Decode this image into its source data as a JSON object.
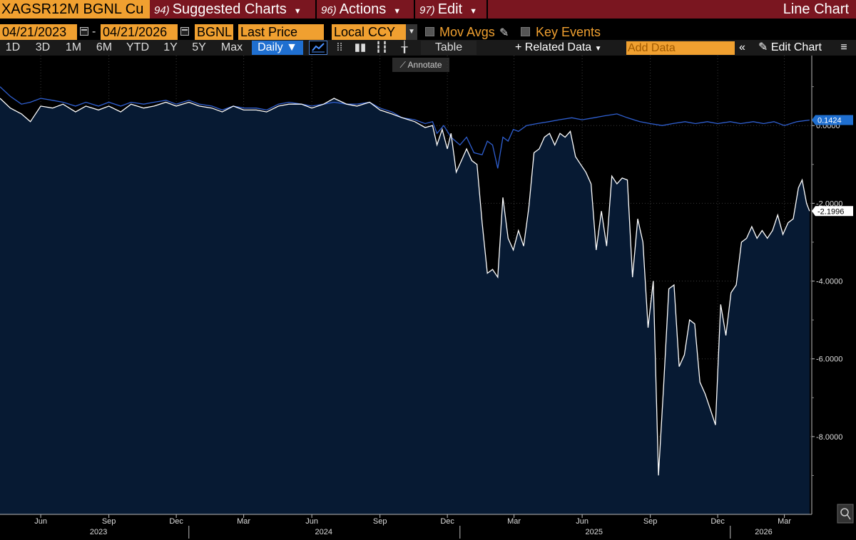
{
  "header": {
    "ticker": "XAGSR12M BGNL Cu",
    "menu": [
      {
        "num": "94)",
        "label": "Suggested Charts"
      },
      {
        "num": "96)",
        "label": "Actions"
      },
      {
        "num": "97)",
        "label": "Edit"
      }
    ],
    "chart_title": "Line Chart"
  },
  "toolbar": {
    "start_date": "04/21/2023",
    "end_date": "04/21/2026",
    "date_sep": "-",
    "source": "BGNL",
    "field": "Last Price",
    "currency": "Local CCY",
    "mov_avgs": "Mov Avgs",
    "key_events": "Key Events"
  },
  "periods": [
    "1D",
    "3D",
    "1M",
    "6M",
    "YTD",
    "1Y",
    "5Y",
    "Max"
  ],
  "frequency": "Daily",
  "table_label": "Table",
  "related_data": "Related Data",
  "add_data_placeholder": "Add Data",
  "edit_chart": "Edit Chart",
  "annotate": "Annotate",
  "colors": {
    "accent_orange": "#f0a030",
    "topbar_red": "#7a1620",
    "area_fill": "#071a33",
    "white_series": "#ffffff",
    "blue_series": "#2f5fd0",
    "active_tab": "#1f6fd0"
  },
  "chart_data": {
    "type": "area",
    "ylim": [
      -10,
      1.8
    ],
    "y_ticks": [
      0,
      -2,
      -4,
      -6,
      -8
    ],
    "y_tick_labels": [
      "0.0000",
      "-2.0000",
      "-4.0000",
      "-6.0000",
      "-8.0000"
    ],
    "x_months": [
      {
        "date": "2023-06-15",
        "label": "Jun"
      },
      {
        "date": "2023-09-15",
        "label": "Sep"
      },
      {
        "date": "2023-12-15",
        "label": "Dec"
      },
      {
        "date": "2024-03-15",
        "label": "Mar"
      },
      {
        "date": "2024-06-15",
        "label": "Jun"
      },
      {
        "date": "2024-09-15",
        "label": "Sep"
      },
      {
        "date": "2024-12-15",
        "label": "Dec"
      },
      {
        "date": "2025-03-15",
        "label": "Mar"
      },
      {
        "date": "2025-06-15",
        "label": "Jun"
      },
      {
        "date": "2025-09-15",
        "label": "Sep"
      },
      {
        "date": "2025-12-15",
        "label": "Dec"
      },
      {
        "date": "2026-03-15",
        "label": "Mar"
      }
    ],
    "x_years": [
      {
        "date": "2023-09-01",
        "label": "2023"
      },
      {
        "date": "2024-07-01",
        "label": "2024"
      },
      {
        "date": "2025-07-01",
        "label": "2025"
      },
      {
        "date": "2026-02-15",
        "label": "2026"
      }
    ],
    "year_boundaries": [
      "2024-01-01",
      "2025-01-01",
      "2026-01-01"
    ],
    "x_range": [
      "2023-04-21",
      "2026-04-21"
    ],
    "grid": true,
    "last_values": [
      {
        "series": "blue",
        "value": 0.1424,
        "label": "0.1424"
      },
      {
        "series": "white",
        "value": -2.1996,
        "label": "-2.1996"
      }
    ],
    "series": [
      {
        "id": "white",
        "area": true,
        "points": [
          [
            "2023-04-21",
            0.7
          ],
          [
            "2023-05-05",
            0.45
          ],
          [
            "2023-05-20",
            0.3
          ],
          [
            "2023-06-01",
            0.1
          ],
          [
            "2023-06-15",
            0.5
          ],
          [
            "2023-07-01",
            0.45
          ],
          [
            "2023-07-15",
            0.55
          ],
          [
            "2023-08-01",
            0.35
          ],
          [
            "2023-08-15",
            0.5
          ],
          [
            "2023-09-01",
            0.4
          ],
          [
            "2023-09-15",
            0.5
          ],
          [
            "2023-10-01",
            0.35
          ],
          [
            "2023-10-15",
            0.55
          ],
          [
            "2023-11-01",
            0.45
          ],
          [
            "2023-11-15",
            0.5
          ],
          [
            "2023-12-01",
            0.6
          ],
          [
            "2023-12-15",
            0.5
          ],
          [
            "2024-01-01",
            0.6
          ],
          [
            "2024-01-15",
            0.5
          ],
          [
            "2024-02-01",
            0.45
          ],
          [
            "2024-02-15",
            0.35
          ],
          [
            "2024-03-01",
            0.5
          ],
          [
            "2024-03-15",
            0.4
          ],
          [
            "2024-04-01",
            0.4
          ],
          [
            "2024-04-15",
            0.35
          ],
          [
            "2024-05-01",
            0.5
          ],
          [
            "2024-05-15",
            0.55
          ],
          [
            "2024-06-01",
            0.55
          ],
          [
            "2024-06-15",
            0.45
          ],
          [
            "2024-07-01",
            0.55
          ],
          [
            "2024-07-15",
            0.7
          ],
          [
            "2024-08-01",
            0.55
          ],
          [
            "2024-08-15",
            0.5
          ],
          [
            "2024-09-01",
            0.6
          ],
          [
            "2024-09-15",
            0.4
          ],
          [
            "2024-10-01",
            0.3
          ],
          [
            "2024-10-15",
            0.2
          ],
          [
            "2024-11-01",
            0.1
          ],
          [
            "2024-11-15",
            -0.05
          ],
          [
            "2024-11-25",
            0.0
          ],
          [
            "2024-12-01",
            -0.5
          ],
          [
            "2024-12-08",
            -0.1
          ],
          [
            "2024-12-15",
            -0.6
          ],
          [
            "2024-12-20",
            -0.2
          ],
          [
            "2024-12-27",
            -1.2
          ],
          [
            "2025-01-03",
            -0.9
          ],
          [
            "2025-01-10",
            -0.6
          ],
          [
            "2025-01-17",
            -0.9
          ],
          [
            "2025-01-24",
            -1.0
          ],
          [
            "2025-01-31",
            -2.5
          ],
          [
            "2025-02-07",
            -3.8
          ],
          [
            "2025-02-14",
            -3.7
          ],
          [
            "2025-02-21",
            -3.9
          ],
          [
            "2025-02-28",
            -1.85
          ],
          [
            "2025-03-07",
            -2.9
          ],
          [
            "2025-03-14",
            -3.2
          ],
          [
            "2025-03-21",
            -2.7
          ],
          [
            "2025-03-28",
            -3.1
          ],
          [
            "2025-04-04",
            -2.1
          ],
          [
            "2025-04-11",
            -0.7
          ],
          [
            "2025-04-18",
            -0.6
          ],
          [
            "2025-04-25",
            -0.3
          ],
          [
            "2025-05-02",
            -0.2
          ],
          [
            "2025-05-09",
            -0.5
          ],
          [
            "2025-05-16",
            -0.2
          ],
          [
            "2025-05-23",
            -0.3
          ],
          [
            "2025-05-30",
            -0.15
          ],
          [
            "2025-06-06",
            -0.8
          ],
          [
            "2025-06-13",
            -1.0
          ],
          [
            "2025-06-20",
            -1.2
          ],
          [
            "2025-06-27",
            -1.5
          ],
          [
            "2025-07-04",
            -3.2
          ],
          [
            "2025-07-11",
            -2.2
          ],
          [
            "2025-07-18",
            -3.1
          ],
          [
            "2025-07-25",
            -1.3
          ],
          [
            "2025-08-01",
            -1.5
          ],
          [
            "2025-08-08",
            -1.35
          ],
          [
            "2025-08-15",
            -1.4
          ],
          [
            "2025-08-22",
            -3.9
          ],
          [
            "2025-08-29",
            -2.4
          ],
          [
            "2025-09-05",
            -3.0
          ],
          [
            "2025-09-12",
            -5.2
          ],
          [
            "2025-09-19",
            -4.0
          ],
          [
            "2025-09-26",
            -9.0
          ],
          [
            "2025-10-03",
            -6.7
          ],
          [
            "2025-10-10",
            -4.2
          ],
          [
            "2025-10-17",
            -4.1
          ],
          [
            "2025-10-24",
            -6.2
          ],
          [
            "2025-10-31",
            -5.9
          ],
          [
            "2025-11-07",
            -5.0
          ],
          [
            "2025-11-14",
            -5.1
          ],
          [
            "2025-11-21",
            -6.6
          ],
          [
            "2025-11-28",
            -6.9
          ],
          [
            "2025-12-05",
            -7.3
          ],
          [
            "2025-12-12",
            -7.7
          ],
          [
            "2025-12-19",
            -4.6
          ],
          [
            "2025-12-26",
            -5.4
          ],
          [
            "2026-01-02",
            -4.3
          ],
          [
            "2026-01-09",
            -4.1
          ],
          [
            "2026-01-16",
            -3.0
          ],
          [
            "2026-01-23",
            -2.9
          ],
          [
            "2026-01-30",
            -2.6
          ],
          [
            "2026-02-06",
            -2.9
          ],
          [
            "2026-02-13",
            -2.7
          ],
          [
            "2026-02-20",
            -2.9
          ],
          [
            "2026-02-27",
            -2.7
          ],
          [
            "2026-03-06",
            -2.3
          ],
          [
            "2026-03-13",
            -2.8
          ],
          [
            "2026-03-20",
            -2.5
          ],
          [
            "2026-03-27",
            -2.4
          ],
          [
            "2026-04-03",
            -1.6
          ],
          [
            "2026-04-08",
            -1.4
          ],
          [
            "2026-04-14",
            -2.0
          ],
          [
            "2026-04-18",
            -2.1996
          ]
        ]
      },
      {
        "id": "blue",
        "area": false,
        "points": [
          [
            "2023-04-21",
            1.0
          ],
          [
            "2023-05-05",
            0.75
          ],
          [
            "2023-05-20",
            0.55
          ],
          [
            "2023-06-01",
            0.6
          ],
          [
            "2023-06-15",
            0.7
          ],
          [
            "2023-07-01",
            0.65
          ],
          [
            "2023-07-15",
            0.6
          ],
          [
            "2023-08-01",
            0.5
          ],
          [
            "2023-08-15",
            0.6
          ],
          [
            "2023-09-01",
            0.5
          ],
          [
            "2023-09-15",
            0.6
          ],
          [
            "2023-10-01",
            0.5
          ],
          [
            "2023-10-15",
            0.6
          ],
          [
            "2023-11-01",
            0.55
          ],
          [
            "2023-11-15",
            0.6
          ],
          [
            "2023-12-01",
            0.65
          ],
          [
            "2023-12-15",
            0.55
          ],
          [
            "2024-01-01",
            0.65
          ],
          [
            "2024-01-15",
            0.55
          ],
          [
            "2024-02-01",
            0.5
          ],
          [
            "2024-02-15",
            0.4
          ],
          [
            "2024-03-01",
            0.5
          ],
          [
            "2024-03-15",
            0.45
          ],
          [
            "2024-04-01",
            0.45
          ],
          [
            "2024-04-15",
            0.4
          ],
          [
            "2024-05-01",
            0.55
          ],
          [
            "2024-05-15",
            0.6
          ],
          [
            "2024-06-01",
            0.55
          ],
          [
            "2024-06-15",
            0.5
          ],
          [
            "2024-07-01",
            0.55
          ],
          [
            "2024-07-15",
            0.6
          ],
          [
            "2024-08-01",
            0.55
          ],
          [
            "2024-08-15",
            0.55
          ],
          [
            "2024-09-01",
            0.6
          ],
          [
            "2024-09-15",
            0.45
          ],
          [
            "2024-10-01",
            0.35
          ],
          [
            "2024-10-15",
            0.2
          ],
          [
            "2024-11-01",
            0.15
          ],
          [
            "2024-11-15",
            0.05
          ],
          [
            "2024-11-25",
            0.1
          ],
          [
            "2024-12-01",
            -0.2
          ],
          [
            "2024-12-10",
            0.0
          ],
          [
            "2024-12-20",
            -0.3
          ],
          [
            "2025-01-01",
            -0.5
          ],
          [
            "2025-01-10",
            -0.3
          ],
          [
            "2025-01-20",
            -0.7
          ],
          [
            "2025-01-31",
            -0.75
          ],
          [
            "2025-02-07",
            -0.4
          ],
          [
            "2025-02-14",
            -0.5
          ],
          [
            "2025-02-21",
            -1.1
          ],
          [
            "2025-02-28",
            -0.3
          ],
          [
            "2025-03-07",
            -0.4
          ],
          [
            "2025-03-14",
            -0.1
          ],
          [
            "2025-03-21",
            -0.15
          ],
          [
            "2025-04-01",
            0.0
          ],
          [
            "2025-04-15",
            0.05
          ],
          [
            "2025-05-01",
            0.1
          ],
          [
            "2025-05-15",
            0.15
          ],
          [
            "2025-06-01",
            0.2
          ],
          [
            "2025-06-15",
            0.15
          ],
          [
            "2025-07-01",
            0.2
          ],
          [
            "2025-07-15",
            0.25
          ],
          [
            "2025-08-01",
            0.3
          ],
          [
            "2025-08-15",
            0.2
          ],
          [
            "2025-09-01",
            0.1
          ],
          [
            "2025-09-15",
            0.05
          ],
          [
            "2025-10-01",
            0.0
          ],
          [
            "2025-10-15",
            0.05
          ],
          [
            "2025-11-01",
            0.1
          ],
          [
            "2025-11-15",
            0.05
          ],
          [
            "2025-12-01",
            0.1
          ],
          [
            "2025-12-15",
            0.05
          ],
          [
            "2026-01-01",
            0.1
          ],
          [
            "2026-01-15",
            0.05
          ],
          [
            "2026-02-01",
            0.1
          ],
          [
            "2026-02-15",
            0.05
          ],
          [
            "2026-03-01",
            0.1
          ],
          [
            "2026-03-15",
            0.0
          ],
          [
            "2026-04-01",
            0.1
          ],
          [
            "2026-04-18",
            0.1424
          ]
        ]
      }
    ]
  }
}
